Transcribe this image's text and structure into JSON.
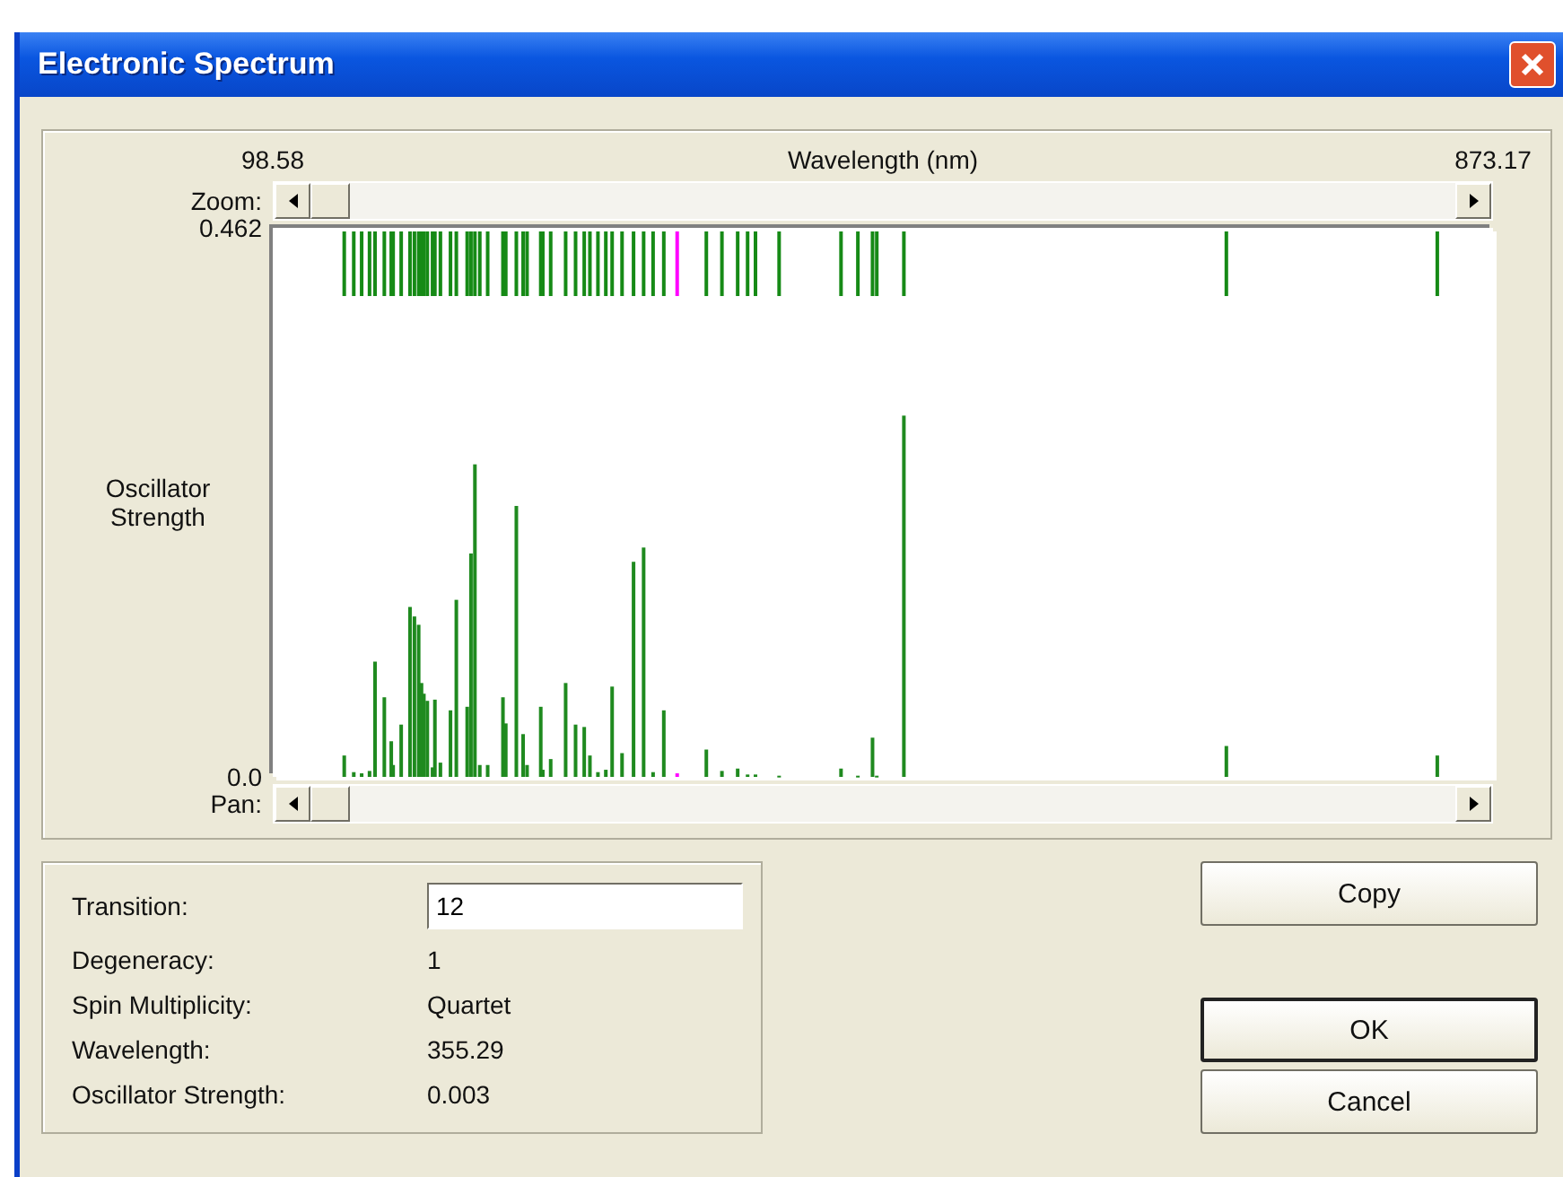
{
  "window": {
    "title": "Electronic Spectrum"
  },
  "spectrum": {
    "zoom_label": "Zoom:",
    "pan_label": "Pan:",
    "chart_data": {
      "type": "bar",
      "xlabel": "Wavelength (nm)",
      "ylabel": "Oscillator Strength",
      "x": [
        143.95,
        150,
        155,
        160,
        163.5,
        169.4,
        173.8,
        175,
        180.1,
        185.7,
        188.5,
        191.2,
        193,
        194.5,
        196.7,
        200,
        201.5,
        205,
        211.4,
        215.1,
        222,
        224.4,
        226.9,
        230,
        235,
        244.7,
        246.5,
        253.2,
        257.5,
        260,
        268.7,
        270,
        275,
        284.5,
        290.8,
        296.3,
        299.9,
        305,
        310,
        314,
        320.3,
        327.6,
        334,
        340,
        346.8,
        355.29,
        373.8,
        383.7,
        393.7,
        400,
        405,
        420,
        459.3,
        470,
        479.3,
        482,
        499.2,
        703.9,
        837.8
      ],
      "series": [
        {
          "color": "#1f8a1f",
          "values": [
            0.018,
            0.004,
            0.003,
            0.005,
            0.097,
            0.067,
            0.03,
            0.01,
            0.044,
            0.143,
            0.135,
            0.128,
            0.079,
            0.07,
            0.064,
            0.008,
            0.065,
            0.012,
            0.056,
            0.149,
            0.059,
            0.188,
            0.263,
            0.01,
            0.01,
            0.067,
            0.045,
            0.228,
            0.036,
            0.01,
            0.059,
            0.006,
            0.015,
            0.079,
            0.044,
            0.042,
            0.018,
            0.004,
            0.006,
            0.076,
            0.02,
            0.181,
            0.193,
            0.004,
            0.056,
            null,
            0.023,
            0.005,
            0.007,
            0.002,
            0.002,
            0.001,
            0.007,
            0.001,
            0.033,
            0.001,
            0.304,
            0.026,
            0.018
          ]
        },
        {
          "color": "#ff00ff",
          "values": [
            null,
            null,
            null,
            null,
            null,
            null,
            null,
            null,
            null,
            null,
            null,
            null,
            null,
            null,
            null,
            null,
            null,
            null,
            null,
            null,
            null,
            null,
            null,
            null,
            null,
            null,
            null,
            null,
            null,
            null,
            null,
            null,
            null,
            null,
            null,
            null,
            null,
            null,
            null,
            null,
            null,
            null,
            null,
            null,
            null,
            0.003,
            null,
            null,
            null,
            null,
            null,
            null,
            null,
            null,
            null,
            null,
            null,
            null,
            null
          ]
        }
      ],
      "xlim": [
        98.58,
        873.17
      ],
      "ylim": [
        0,
        0.462
      ],
      "xticks": [
        {
          "value": 98.58,
          "label": "98.58"
        },
        {
          "value": 873.17,
          "label": "873.17"
        }
      ],
      "yticks": [
        {
          "value": 0,
          "label": "0.0"
        },
        {
          "value": 0.462,
          "label": "0.462"
        }
      ]
    }
  },
  "details": [
    {
      "label": "Transition:",
      "value": "12",
      "kind": "field"
    },
    {
      "label": "Degeneracy:",
      "value": "1",
      "kind": "text"
    },
    {
      "label": "Spin Multiplicity:",
      "value": "Quartet",
      "kind": "text"
    },
    {
      "label": "Wavelength:",
      "value": "355.29",
      "kind": "text"
    },
    {
      "label": "Oscillator Strength:",
      "value": "0.003",
      "kind": "text"
    }
  ],
  "buttons": [
    {
      "label": "Copy",
      "default": false
    },
    {
      "label": "OK",
      "default": true
    },
    {
      "label": "Cancel",
      "default": false
    }
  ]
}
